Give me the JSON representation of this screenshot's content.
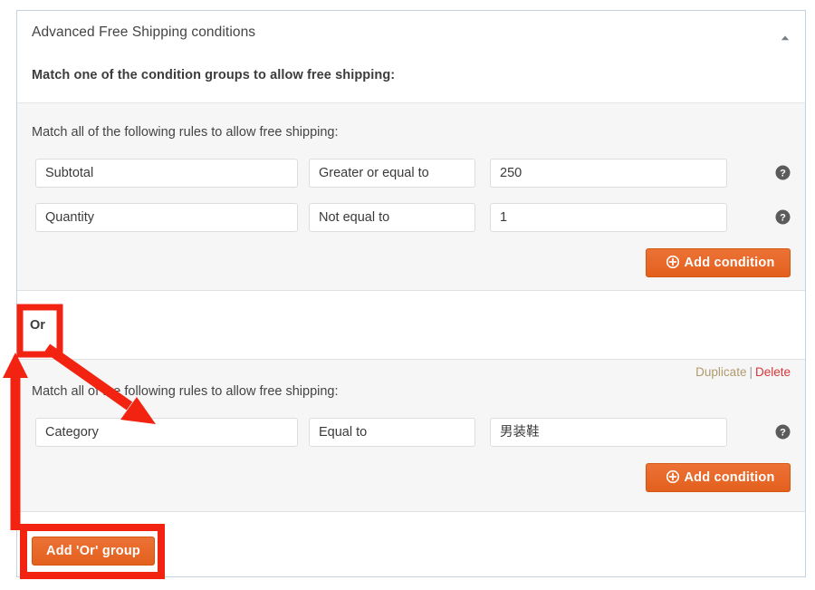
{
  "panel": {
    "title": "Advanced Free Shipping conditions",
    "subtitle": "Match one of the condition groups to allow free shipping:",
    "toggle_icon": "caret-up-icon",
    "accent_color": "#e8692a",
    "border_color": "#c3d4de",
    "group_bg": "#f6f6f6"
  },
  "groups": [
    {
      "label": "Match all of the following rules to allow free shipping:",
      "actions": null,
      "rules": [
        {
          "field": "Subtotal",
          "field_control": "select",
          "operator": "Greater or equal to",
          "operator_control": "select",
          "value": "250",
          "value_control": "text",
          "help_icon": "help-circle-icon"
        },
        {
          "field": "Quantity",
          "field_control": "select",
          "operator": "Not equal to",
          "operator_control": "select",
          "value": "1",
          "value_control": "text",
          "help_icon": "help-circle-icon"
        }
      ],
      "add_condition_label": "Add condition",
      "add_condition_icon": "circle-plus-icon"
    },
    {
      "label": "Match all of the following rules to allow free shipping:",
      "actions": {
        "duplicate_label": "Duplicate",
        "separator": "|",
        "delete_label": "Delete",
        "duplicate_color": "#b19a6b",
        "delete_color": "#d63638"
      },
      "rules": [
        {
          "field": "Category",
          "field_control": "select",
          "operator": "Equal to",
          "operator_control": "select",
          "value": "男装鞋",
          "value_control": "select2",
          "help_icon": "help-circle-icon"
        }
      ],
      "add_condition_label": "Add condition",
      "add_condition_icon": "circle-plus-icon"
    }
  ],
  "or_band": {
    "label": "Or"
  },
  "footer": {
    "add_or_group_label": "Add 'Or' group"
  },
  "annotations": {
    "color": "#f22411",
    "highlight_or_box": "rectangle around 'Or' label",
    "highlight_add_or_group_box": "rectangle around Add 'Or' group button",
    "arrow_up": "arrow from Add 'Or' group box up to 'Or' box",
    "arrow_diagonal": "arrow from 'Or' box down-right into second group rules"
  }
}
